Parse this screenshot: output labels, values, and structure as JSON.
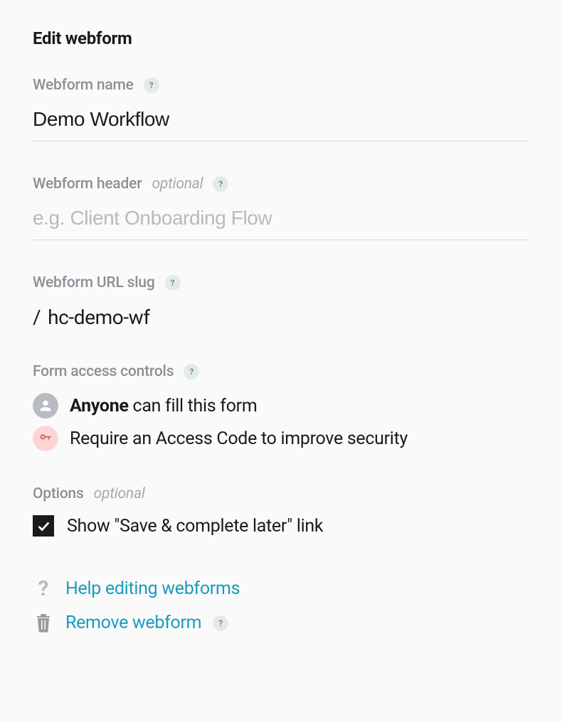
{
  "page_title": "Edit webform",
  "fields": {
    "name": {
      "label": "Webform name",
      "value": "Demo Workflow"
    },
    "header": {
      "label": "Webform header",
      "optional_tag": "optional",
      "placeholder": "e.g. Client Onboarding Flow",
      "value": ""
    },
    "slug": {
      "label": "Webform URL slug",
      "prefix": "/",
      "value": "hc-demo-wf"
    }
  },
  "access": {
    "label": "Form access controls",
    "anyone_strong": "Anyone",
    "anyone_rest": " can fill this form",
    "require_code": "Require an Access Code to improve security"
  },
  "options": {
    "label": "Options",
    "optional_tag": "optional",
    "show_save_link": "Show \"Save & complete later\" link"
  },
  "footer": {
    "help_link": "Help editing webforms",
    "remove_link": "Remove webform"
  },
  "help_glyph": "?"
}
